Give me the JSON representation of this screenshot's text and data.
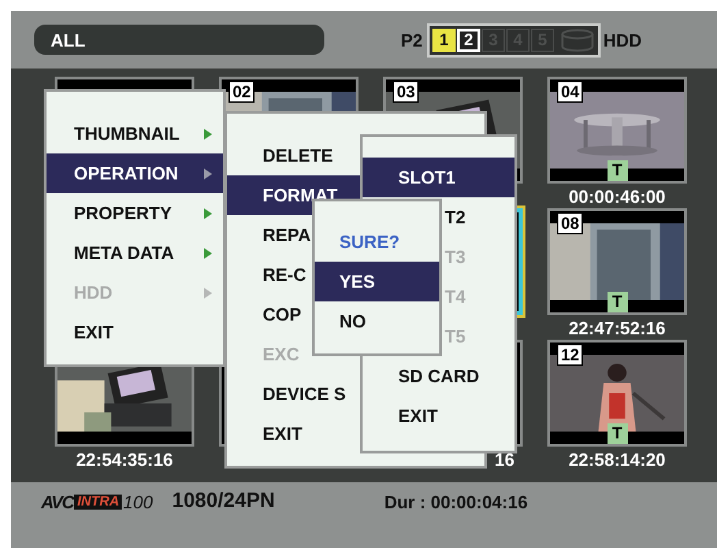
{
  "top_bar": {
    "filter": "ALL",
    "card_label": "P2",
    "slots": [
      {
        "label": "1",
        "selected": true,
        "available": true
      },
      {
        "label": "2",
        "selected": false,
        "available": true
      },
      {
        "label": "3",
        "selected": false,
        "available": false
      },
      {
        "label": "4",
        "selected": false,
        "available": false
      },
      {
        "label": "5",
        "selected": false,
        "available": false
      }
    ],
    "drive_label": "HDD"
  },
  "thumbnail_rows": [
    {
      "cells": [
        {
          "selected": false
        },
        {
          "label": "02",
          "kind": "picture",
          "selected": false
        },
        {
          "label": "03",
          "kind": "picture",
          "selected": false
        },
        {
          "label": "04",
          "kind": "picture",
          "badge": "T",
          "timecode": "00:00:46:00",
          "selected": false
        }
      ]
    },
    {
      "cells": [
        {
          "selected": true
        },
        {
          "label": "08",
          "kind": "picture",
          "badge": "T",
          "timecode": "22:47:52:16",
          "selected": false
        }
      ]
    },
    {
      "cells": [
        {
          "kind": "picture",
          "timecode": "22:54:35:16",
          "selected": false
        },
        {
          "selected": false
        },
        {
          "timecode": "16",
          "selected": false
        },
        {
          "label": "12",
          "kind": "picture",
          "badge": "T",
          "timecode": "22:58:14:20",
          "selected": false
        }
      ]
    }
  ],
  "menus": [
    {
      "items": [
        {
          "label": "THUMBNAIL",
          "submenu": true,
          "selected": false,
          "disabled": false
        },
        {
          "label": "OPERATION",
          "submenu": true,
          "selected": true,
          "disabled": false
        },
        {
          "label": "PROPERTY",
          "submenu": true,
          "selected": false,
          "disabled": false
        },
        {
          "label": "META DATA",
          "submenu": true,
          "selected": false,
          "disabled": false
        },
        {
          "label": "HDD",
          "submenu": true,
          "selected": false,
          "disabled": true
        },
        {
          "label": "EXIT",
          "submenu": false,
          "selected": false,
          "disabled": false
        }
      ]
    },
    {
      "items": [
        {
          "label": "DELETE",
          "selected": false,
          "disabled": false
        },
        {
          "label": "FORMAT",
          "selected": true,
          "disabled": false
        },
        {
          "label": "REPA",
          "selected": false,
          "disabled": false
        },
        {
          "label": "RE-C",
          "selected": false,
          "disabled": false
        },
        {
          "label": "COP",
          "selected": false,
          "disabled": false
        },
        {
          "label": "EXC",
          "selected": false,
          "disabled": true
        },
        {
          "label": "DEVICE S",
          "selected": false,
          "disabled": false
        },
        {
          "label": "EXIT",
          "selected": false,
          "disabled": false
        }
      ]
    },
    {
      "items": [
        {
          "label": "SLOT1",
          "selected": true,
          "disabled": false,
          "covered": false
        },
        {
          "label": "T2",
          "selected": false,
          "disabled": false,
          "covered": true
        },
        {
          "label": "T3",
          "selected": false,
          "disabled": true,
          "covered": true
        },
        {
          "label": "T4",
          "selected": false,
          "disabled": true,
          "covered": true
        },
        {
          "label": "T5",
          "selected": false,
          "disabled": true,
          "covered": true
        },
        {
          "label": "SD CARD",
          "selected": false,
          "disabled": false,
          "covered": false
        },
        {
          "label": "EXIT",
          "selected": false,
          "disabled": false,
          "covered": false
        }
      ]
    }
  ],
  "dialog": {
    "question": "SURE?",
    "options": [
      {
        "label": "YES",
        "selected": true
      },
      {
        "label": "NO",
        "selected": false
      }
    ]
  },
  "status_bar": {
    "codec": [
      "AVC",
      "INTRA",
      "100"
    ],
    "format": "1080/24PN",
    "duration": "Dur : 00:00:04:16"
  }
}
